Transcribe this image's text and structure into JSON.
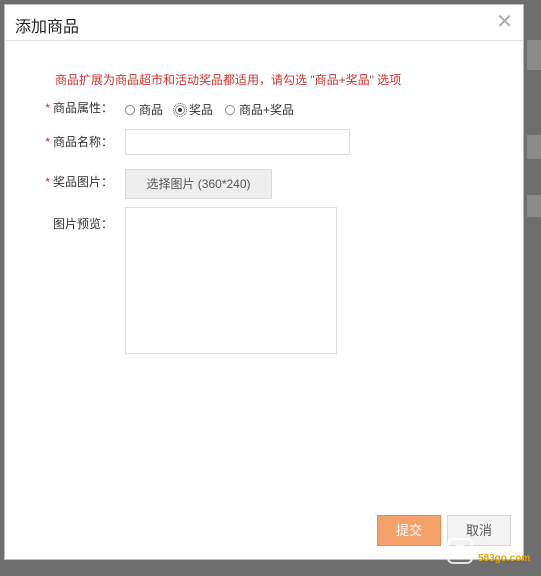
{
  "dialog": {
    "title": "添加商品",
    "close_glyph": "✕"
  },
  "notice": "商品扩展为商品超市和活动奖品都适用，请勾选 \"商品+奖品\" 选项",
  "form": {
    "attribute": {
      "required_mark": "*",
      "label": "商品属性：",
      "options": [
        {
          "label": "商品",
          "checked": false
        },
        {
          "label": "奖品",
          "checked": true
        },
        {
          "label": "商品+奖品",
          "checked": false
        }
      ]
    },
    "name": {
      "required_mark": "*",
      "label": "商品名称：",
      "value": ""
    },
    "image": {
      "required_mark": "*",
      "label": "奖品图片：",
      "button_label": "选择图片 (360*240)"
    },
    "preview": {
      "label": "图片预览："
    }
  },
  "footer": {
    "submit_label": "提交",
    "cancel_label": "取消"
  },
  "watermark": {
    "text": "583go.com"
  },
  "colors": {
    "notice": "#cc3333",
    "required": "#dd2222",
    "submit_bg": "#f4a16b"
  }
}
